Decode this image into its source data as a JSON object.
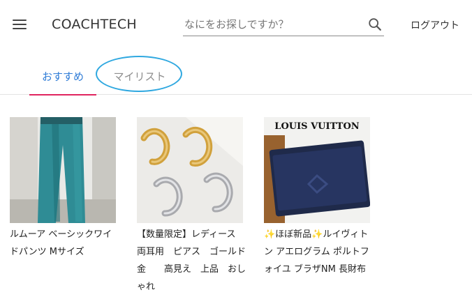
{
  "header": {
    "brand": "COACHTECH",
    "search": {
      "placeholder": "なにをお探しですか？",
      "value": ""
    },
    "logout_label": "ログアウト",
    "icons": {
      "menu": "hamburger-menu-icon",
      "search": "search-icon"
    }
  },
  "tabs": [
    {
      "label": "おすすめ",
      "active": true
    },
    {
      "label": "マイリスト",
      "active": false
    }
  ],
  "colors": {
    "active_tab_text": "#2e7bd6",
    "active_tab_underline": "#e0245e",
    "inactive_tab_text": "#8d8d8d",
    "highlight_ring": "#2fa8e0"
  },
  "products": [
    {
      "name": "ルムーア ベーシックワイドパンツ Mサイズ",
      "image": "teal-wide-pants-photo"
    },
    {
      "name": "【数量限定】レディース　両耳用　ピアス　ゴールド　金　　高見え　上品　おしゃれ",
      "image": "gold-silver-hoop-earrings-photo"
    },
    {
      "name": "✨ほぼ新品✨ルイヴィトン アエログラム ポルトフォイユ ブラザNM 長財布",
      "image": "navy-leather-wallet-photo",
      "image_text": "LOUIS VUITTON"
    }
  ]
}
